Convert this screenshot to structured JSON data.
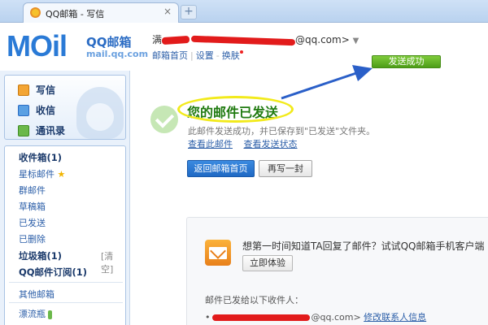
{
  "browser": {
    "tab_title": "QQ邮箱 - 写信",
    "close_glyph": "×",
    "new_tab_glyph": "+"
  },
  "header": {
    "logo_mark": "MOil",
    "logo_brand": "QQ邮箱",
    "logo_domain": "mail.qq.com",
    "user_name": "满",
    "user_email_suffix": "@qq.com>",
    "dropdown_glyph": "▼",
    "nav": {
      "home": "邮箱首页",
      "settings": "设置",
      "skin": "换肤",
      "separator": "|",
      "separator2": "-"
    }
  },
  "toast": "发送成功",
  "sidebar": {
    "top_items": [
      "写信",
      "收信",
      "通讯录"
    ],
    "folders": {
      "inbox": "收件箱(1)",
      "starred": "星标邮件",
      "star_glyph": "★",
      "group": "群邮件",
      "drafts": "草稿箱",
      "sent": "已发送",
      "deleted": "已删除",
      "spam": "垃圾箱(1)",
      "spam_clear": "[清空]",
      "subscriptions": "QQ邮件订阅(1)",
      "other": "其他邮箱",
      "drift": "漂流瓶"
    }
  },
  "main": {
    "headline": "您的邮件已发送",
    "description": "此邮件发送成功，并已保存到\"已发送\"文件夹。",
    "link_view": "查看此邮件",
    "link_status": "查看发送状态",
    "btn_home": "返回邮箱首页",
    "btn_rewrite": "再写一封",
    "promo_text": "想第一时间知道TA回复了邮件？试试QQ邮箱手机客户端",
    "btn_try": "立即体验",
    "recipients_label": "邮件已发给以下收件人：",
    "recipient_prefix": "•",
    "recipient_email_suffix": "@qq.com>",
    "edit_contact": "修改联系人信息"
  },
  "colors": {
    "accent": "#2b6cc4",
    "success": "#4d9d17",
    "annotation_arrow": "#2a5fc8",
    "highlight_oval": "#f2ea1b",
    "redaction": "#e21b1b"
  }
}
